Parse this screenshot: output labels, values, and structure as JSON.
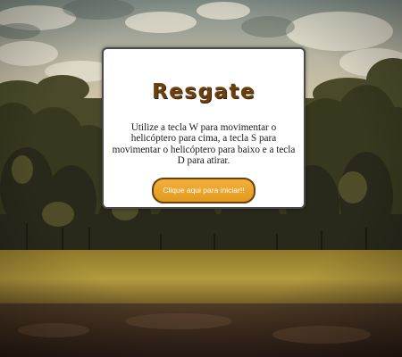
{
  "game": {
    "title": "Resgate",
    "instructions": "Utilize a tecla W para movimentar o helicóptero para cima, a tecla S para movimentar o helicóptero para baixo e a tecla D para atirar.",
    "start_button_label": "Clique aqui para iniciar!!"
  },
  "colors": {
    "title": "#6b3f0e",
    "button_fill": "#e9a42c",
    "button_border": "#6b3f0e",
    "modal_background": "#ffffff"
  }
}
